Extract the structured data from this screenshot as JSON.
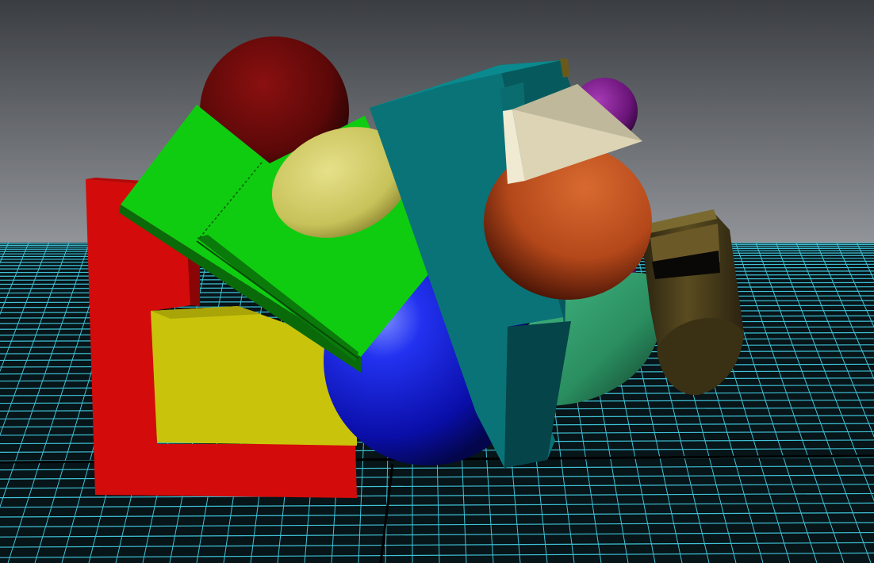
{
  "scene": {
    "background_sky_top": "#3a3d41",
    "background_sky_bottom": "#8f9297",
    "floor_base": "#000000",
    "grid_line_color": "#3fc2d6",
    "grid_axis_color": "#000000",
    "objects": [
      {
        "name": "red-block",
        "color": "#d20a0a"
      },
      {
        "name": "yellow-block",
        "color": "#c8c30a"
      },
      {
        "name": "green-slab",
        "color": "#10cc10"
      },
      {
        "name": "maroon-sphere",
        "color": "#6a0e0e"
      },
      {
        "name": "khaki-ellipsoid",
        "color": "#d2cd66"
      },
      {
        "name": "blue-sphere",
        "color": "#1e28e0"
      },
      {
        "name": "teal-slab",
        "color": "#0a7476"
      },
      {
        "name": "purple-sphere",
        "color": "#7a1a8a"
      },
      {
        "name": "cream-pyramid",
        "color": "#d8d0b0"
      },
      {
        "name": "orange-sphere",
        "color": "#c4501e"
      },
      {
        "name": "seafoam-cylinder",
        "color": "#2fa070"
      },
      {
        "name": "olive-cylinder",
        "color": "#4a3e18"
      }
    ]
  }
}
